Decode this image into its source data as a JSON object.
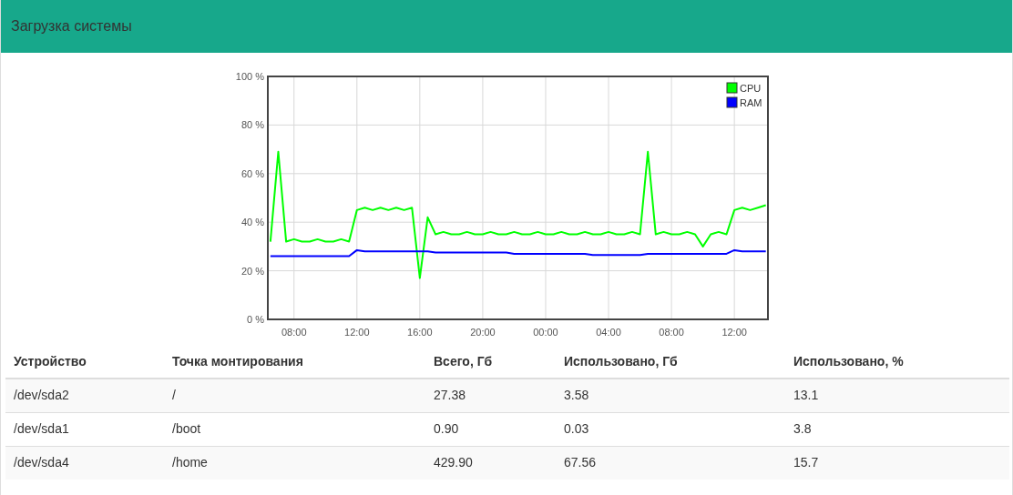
{
  "header": {
    "title": "Загрузка системы"
  },
  "chart": {
    "chart_data": {
      "type": "line",
      "categories": [
        null,
        null,
        null,
        "08:00",
        null,
        null,
        null,
        null,
        null,
        null,
        null,
        "12:00",
        null,
        null,
        null,
        null,
        null,
        null,
        null,
        "16:00",
        null,
        null,
        null,
        null,
        null,
        null,
        null,
        "20:00",
        null,
        null,
        null,
        null,
        null,
        null,
        null,
        "00:00",
        null,
        null,
        null,
        null,
        null,
        null,
        null,
        "04:00",
        null,
        null,
        null,
        null,
        null,
        null,
        null,
        "08:00",
        null,
        null,
        null,
        null,
        null,
        null,
        null,
        "12:00",
        null,
        null,
        null,
        null
      ],
      "series": [
        {
          "name": "CPU",
          "color": "#00ff00",
          "values": [
            32,
            69,
            32,
            33,
            32,
            32,
            33,
            32,
            32,
            33,
            32,
            45,
            46,
            45,
            46,
            45,
            46,
            45,
            46,
            17,
            42,
            35,
            36,
            35,
            35,
            36,
            35,
            35,
            36,
            35,
            35,
            36,
            35,
            35,
            36,
            35,
            35,
            36,
            35,
            35,
            36,
            35,
            35,
            36,
            35,
            35,
            36,
            35,
            69,
            35,
            36,
            35,
            35,
            36,
            35,
            30,
            35,
            36,
            35,
            45,
            46,
            45,
            46,
            47
          ]
        },
        {
          "name": "RAM",
          "color": "#0000ff",
          "values": [
            26,
            26,
            26,
            26,
            26,
            26,
            26,
            26,
            26,
            26,
            26,
            28.5,
            28,
            28,
            28,
            28,
            28,
            28,
            28,
            28,
            28,
            27.5,
            27.5,
            27.5,
            27.5,
            27.5,
            27.5,
            27.5,
            27.5,
            27.5,
            27.5,
            27,
            27,
            27,
            27,
            27,
            27,
            27,
            27,
            27,
            27,
            26.5,
            26.5,
            26.5,
            26.5,
            26.5,
            26.5,
            26.5,
            27,
            27,
            27,
            27,
            27,
            27,
            27,
            27,
            27,
            27,
            27,
            28.5,
            28,
            28,
            28,
            28
          ]
        }
      ],
      "ylim": [
        0,
        100
      ],
      "grid": true,
      "legend": true,
      "yticks": [
        {
          "value": 0,
          "label": "0 %"
        },
        {
          "value": 20,
          "label": "20 %"
        },
        {
          "value": 40,
          "label": "40 %"
        },
        {
          "value": 60,
          "label": "60 %"
        },
        {
          "value": 80,
          "label": "80 %"
        },
        {
          "value": 100,
          "label": "100 %"
        }
      ]
    }
  },
  "table": {
    "columns": [
      "Устройство",
      "Точка монтирования",
      "Всего, Гб",
      "Использовано, Гб",
      "Использовано, %"
    ],
    "rows": [
      [
        "/dev/sda2",
        "/",
        "27.38",
        "3.58",
        "13.1"
      ],
      [
        "/dev/sda1",
        "/boot",
        "0.90",
        "0.03",
        "3.8"
      ],
      [
        "/dev/sda4",
        "/home",
        "429.90",
        "67.56",
        "15.7"
      ]
    ]
  }
}
